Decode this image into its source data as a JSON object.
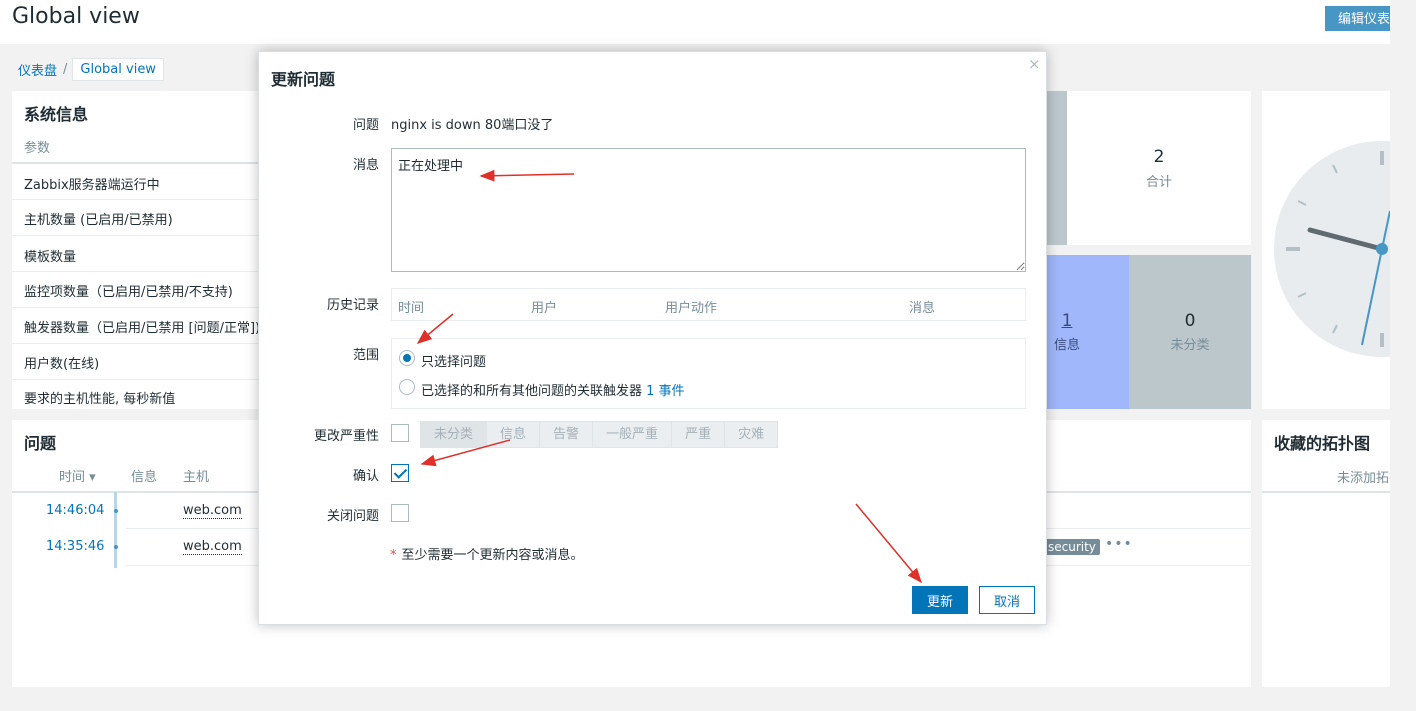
{
  "page": {
    "title": "Global view",
    "edit_button": "编辑仪表盘"
  },
  "breadcrumb": {
    "root": "仪表盘",
    "separator": "/",
    "current": "Global view"
  },
  "system_info": {
    "title": "系统信息",
    "column_header": "参数",
    "rows": [
      "Zabbix服务器端运行中",
      "主机数量 (已启用/已禁用)",
      "模板数量",
      "监控项数量（已启用/已禁用/不支持)",
      "触发器数量（已启用/已禁用 [问题/正常])",
      "用户数(在线)",
      "要求的主机性能, 每秒新值"
    ]
  },
  "problems": {
    "title": "问题",
    "headers": {
      "time": "时间 ▾",
      "info": "信息",
      "host": "主机"
    },
    "rows": [
      {
        "time": "14:46:04",
        "host": "web.com"
      },
      {
        "time": "14:35:46",
        "host": "web.com"
      }
    ],
    "tag": "security",
    "more": "•••"
  },
  "stats": {
    "total": {
      "value": "2",
      "label": "合计"
    },
    "info": {
      "value": "1",
      "label": "信息"
    },
    "unclassified": {
      "value": "0",
      "label": "未分类"
    },
    "colors": {
      "info": "#a1b7fb",
      "unclassified": "#bcc7cc"
    }
  },
  "favorites": {
    "title": "收藏的拓扑图",
    "empty": "未添加拓扑图"
  },
  "modal": {
    "title": "更新问题",
    "close": "×",
    "problem_label": "问题",
    "problem_value": "nginx is down 80端口没了",
    "message_label": "消息",
    "message_value": "正在处理中",
    "history_label": "历史记录",
    "history_cols": {
      "time": "时间",
      "user": "用户",
      "action": "用户动作",
      "message": "消息"
    },
    "scope_label": "范围",
    "scope_option1": "只选择问题",
    "scope_option2": "已选择的和所有其他问题的关联触发器",
    "scope_link": "1 事件",
    "change_severity_label": "更改严重性",
    "severities": [
      "未分类",
      "信息",
      "告警",
      "一般严重",
      "严重",
      "灾难"
    ],
    "acknowledge_label": "确认",
    "close_problem_label": "关闭问题",
    "required_star": "*",
    "required_note": "至少需要一个更新内容或消息。",
    "update_button": "更新",
    "cancel_button": "取消"
  },
  "colors": {
    "accent": "#0275b8",
    "annotation": "#e0302a"
  }
}
